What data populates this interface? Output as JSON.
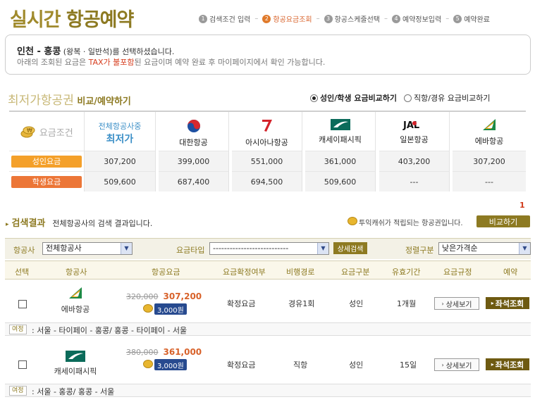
{
  "header": {
    "title_part1": "실시간 ",
    "title_part2": "항공예약"
  },
  "steps": [
    {
      "num": "1",
      "label": "검색조건 입력",
      "active": false
    },
    {
      "num": "2",
      "label": "항공요금조회",
      "active": true
    },
    {
      "num": "3",
      "label": "항공스케줄선택",
      "active": false
    },
    {
      "num": "4",
      "label": "예약정보입력",
      "active": false
    },
    {
      "num": "5",
      "label": "예약완료",
      "active": false
    }
  ],
  "info": {
    "route": "인천 - 홍콩",
    "route_desc": " (왕복 · 일반석)를 선택하셨습니다.",
    "notice_pre": "아래의 조회된 요금은 ",
    "notice_red": "TAX가 불포함",
    "notice_post": "된 요금이며 예약 완료 후 마이페이지에서 확인 가능합니다."
  },
  "compare": {
    "title": "최저가항공권",
    "subtitle": " 비교/예약하기",
    "radio1": "성인/학생 요금비교하기",
    "radio2": "직항/경유 요금비교하기",
    "label_icon_text": "요금조건",
    "row_labels": [
      "성인요금",
      "학생요금"
    ],
    "lowest_header_line1": "전체항공사중",
    "lowest_header_line2": "최저가",
    "lowest_adult": "307,200",
    "lowest_student": "509,600",
    "airlines": [
      {
        "name": "대한항공",
        "adult": "399,000",
        "student": "687,400"
      },
      {
        "name": "아시아나항공",
        "adult": "551,000",
        "student": "694,500"
      },
      {
        "name": "캐세이패시픽",
        "adult": "361,000",
        "student": "509,600"
      },
      {
        "name": "일본항공",
        "adult": "403,200",
        "student": "---"
      },
      {
        "name": "에바항공",
        "adult": "307,200",
        "student": "---"
      }
    ],
    "page": "1"
  },
  "results": {
    "title": "검색결과",
    "desc": "전체항공사의 검색 결과입니다.",
    "note": "투익캐쉬가 적립되는 항공권입니다.",
    "compare_button": "비교하기",
    "filter": {
      "airline_label": "항공사",
      "airline_value": "전체항공사",
      "fare_type_label": "요금타입",
      "fare_type_value": "---------------------------",
      "detail_search": "상세검색",
      "sort_label": "정렬구분",
      "sort_value": "낮은가격순"
    },
    "columns": [
      "선택",
      "항공사",
      "항공요금",
      "요금확정여부",
      "비행경로",
      "요금구분",
      "유효기간",
      "요금규정",
      "예약"
    ],
    "rows": [
      {
        "airline": "에바항공",
        "old_price": "320,000",
        "price": "307,200",
        "mileage": "3,000원",
        "fare_status": "확정요금",
        "route_type": "경유1회",
        "fare_class": "성인",
        "validity": "1개월",
        "detail_btn": "상세보기",
        "seat_btn": "좌석조회",
        "itin_tag": "여정",
        "itinerary": ": 서울 - 타이페이 - 홍콩/ 홍콩 - 타이페이 - 서울"
      },
      {
        "airline": "캐세이패시픽",
        "old_price": "380,000",
        "price": "361,000",
        "mileage": "3,000원",
        "fare_status": "확정요금",
        "route_type": "직항",
        "fare_class": "성인",
        "validity": "15일",
        "detail_btn": "상세보기",
        "seat_btn": "좌석조회",
        "itin_tag": "여정",
        "itinerary": ": 서울 - 홍콩/ 홍콩 - 서울"
      }
    ]
  }
}
